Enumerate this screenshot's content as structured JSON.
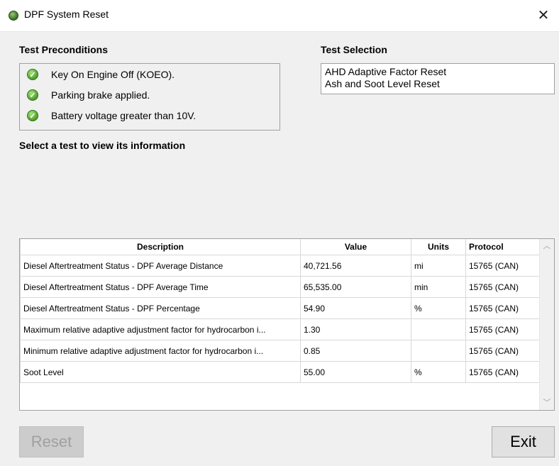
{
  "window": {
    "title": "DPF System Reset",
    "close_glyph": "✕"
  },
  "preconditions": {
    "heading": "Test Preconditions",
    "items": [
      {
        "label": "Key On Engine Off (KOEO)."
      },
      {
        "label": "Parking brake applied."
      },
      {
        "label": "Battery voltage greater than 10V."
      }
    ]
  },
  "test_selection": {
    "heading": "Test Selection",
    "items": [
      {
        "label": "AHD Adaptive Factor Reset"
      },
      {
        "label": "Ash and Soot Level Reset"
      }
    ]
  },
  "info_prompt": "Select a test to view its information",
  "grid": {
    "columns": [
      "Description",
      "Value",
      "Units",
      "Protocol"
    ],
    "rows": [
      {
        "description": "Diesel Aftertreatment Status - DPF Average Distance",
        "value": "40,721.56",
        "units": "mi",
        "protocol": "15765 (CAN)"
      },
      {
        "description": "Diesel Aftertreatment Status - DPF Average Time",
        "value": "65,535.00",
        "units": "min",
        "protocol": "15765 (CAN)"
      },
      {
        "description": "Diesel Aftertreatment Status - DPF Percentage",
        "value": "54.90",
        "units": "%",
        "protocol": "15765 (CAN)"
      },
      {
        "description": "Maximum relative adaptive adjustment factor for hydrocarbon i...",
        "value": "1.30",
        "units": "",
        "protocol": "15765 (CAN)"
      },
      {
        "description": "Minimum relative adaptive adjustment factor for hydrocarbon i...",
        "value": "0.85",
        "units": "",
        "protocol": "15765 (CAN)"
      },
      {
        "description": "Soot Level",
        "value": "55.00",
        "units": "%",
        "protocol": "15765 (CAN)"
      }
    ]
  },
  "buttons": {
    "reset": "Reset",
    "exit": "Exit"
  },
  "icons": {
    "app": "dpf-app-icon",
    "check": "green-check-icon",
    "close": "close-icon"
  }
}
